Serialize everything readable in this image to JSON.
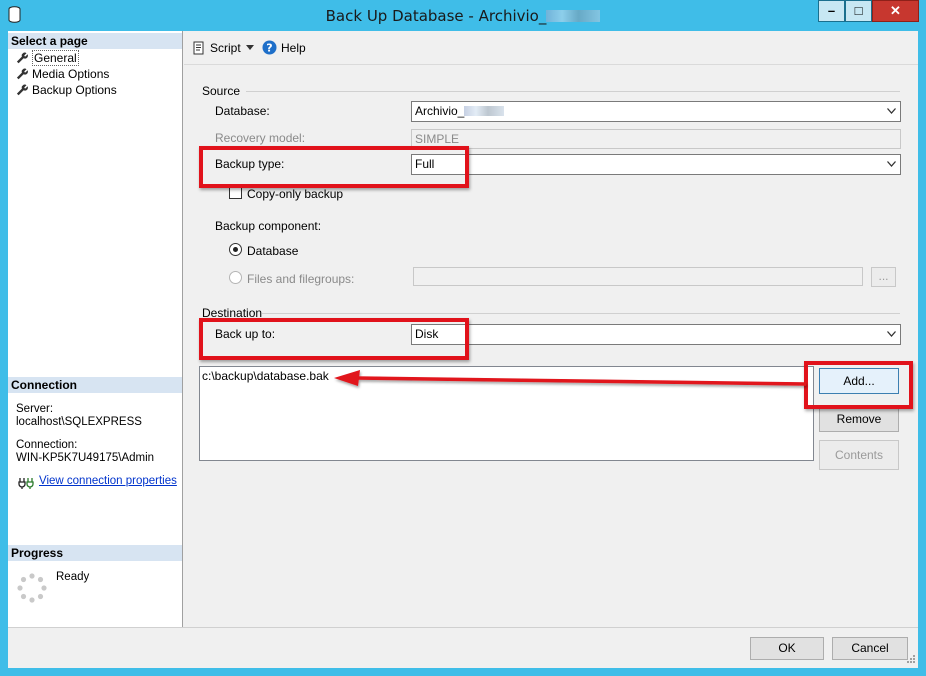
{
  "window": {
    "title_visible": "Back Up Database - Archivio_",
    "minimize_glyph": "–",
    "maximize_glyph": "□",
    "close_glyph": "✕"
  },
  "left_pane": {
    "select_page_heading": "Select a page",
    "pages": [
      {
        "label": "General",
        "icon": "wrench-icon",
        "selected": true
      },
      {
        "label": "Media Options",
        "icon": "wrench-icon",
        "selected": false
      },
      {
        "label": "Backup Options",
        "icon": "wrench-icon",
        "selected": false
      }
    ],
    "connection": {
      "heading": "Connection",
      "server_label": "Server:",
      "server_value": "localhost\\SQLEXPRESS",
      "connection_label": "Connection:",
      "connection_value": "WIN-KP5K7U49175\\Admin",
      "view_link": "View connection properties"
    },
    "progress": {
      "heading": "Progress",
      "status": "Ready"
    }
  },
  "toolbar": {
    "script_label": "Script",
    "help_label": "Help"
  },
  "source": {
    "group_label": "Source",
    "database_label": "Database:",
    "database_value": "Archivio_",
    "recovery_label": "Recovery model:",
    "recovery_value": "SIMPLE",
    "backup_type_label": "Backup type:",
    "backup_type_value": "Full",
    "copy_only_label": "Copy-only backup",
    "copy_only_checked": false,
    "component_label": "Backup component:",
    "component_database": "Database",
    "component_files": "Files and filegroups:",
    "browse_label": "..."
  },
  "destination": {
    "group_label": "Destination",
    "backup_to_label": "Back up to:",
    "backup_to_value": "Disk",
    "files": [
      "c:\\backup\\database.bak"
    ],
    "add_label": "Add...",
    "remove_label": "Remove",
    "contents_label": "Contents"
  },
  "footer": {
    "ok_label": "OK",
    "cancel_label": "Cancel"
  },
  "colors": {
    "title_bar": "#3fbde8",
    "highlight_red": "#e1121b",
    "link_blue": "#0033cc",
    "section_header": "#d7e4f2"
  }
}
